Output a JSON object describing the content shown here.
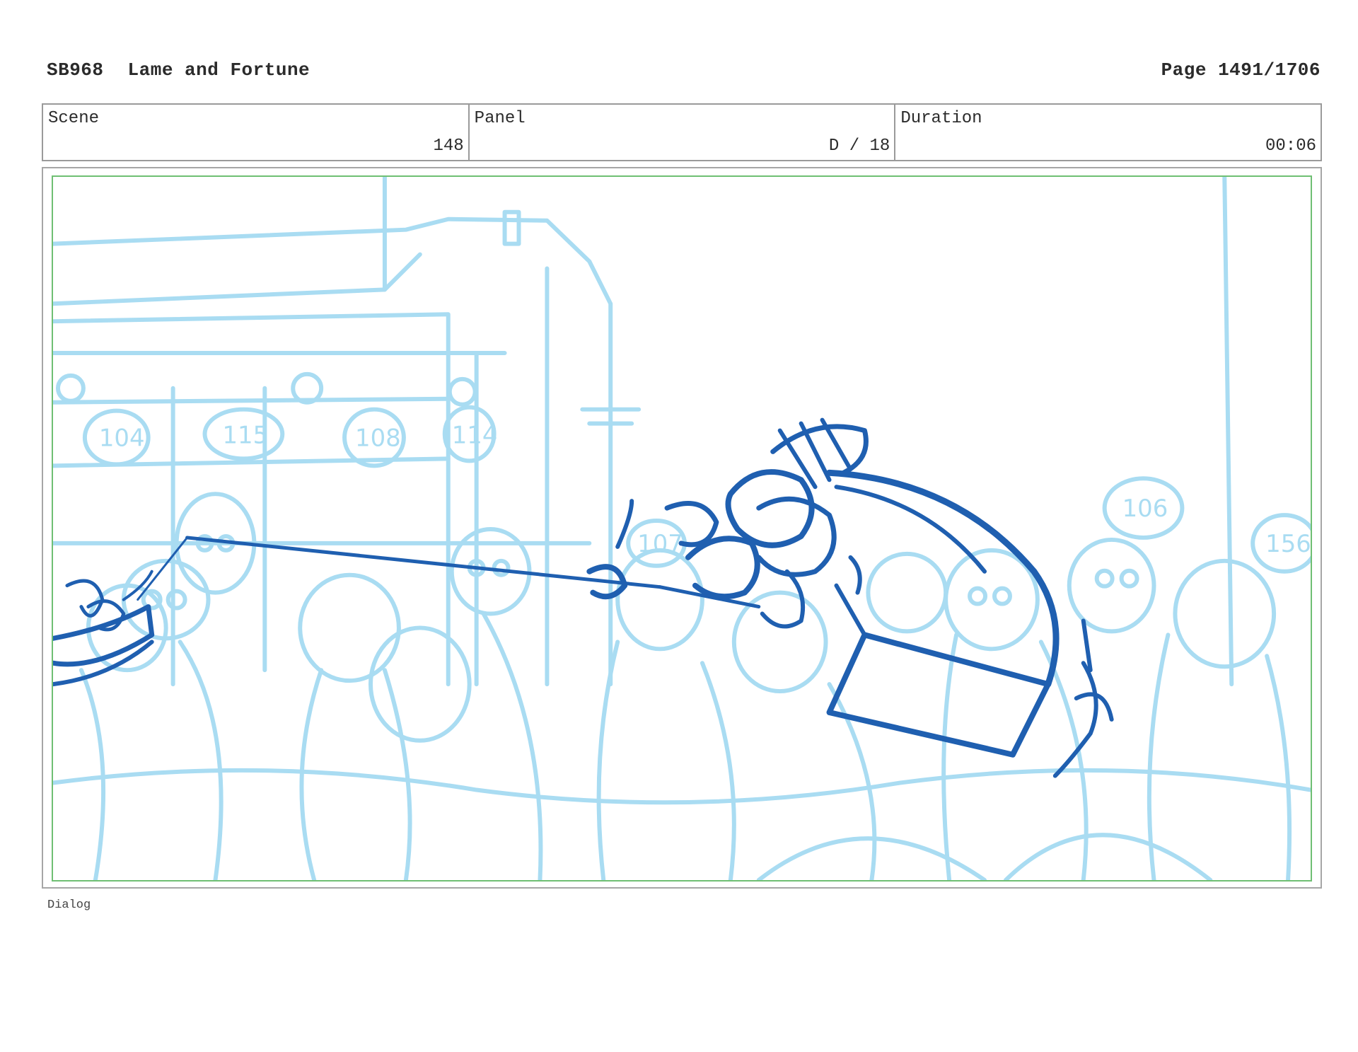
{
  "header": {
    "code": "SB968",
    "title": "Lame and Fortune",
    "page": "Page 1491/1706"
  },
  "info": {
    "scene_label": "Scene",
    "scene_value": "148",
    "panel_label": "Panel",
    "panel_value": "D / 18",
    "duration_label": "Duration",
    "duration_value": "00:06"
  },
  "sketch": {
    "crowd_numbers": [
      "104",
      "115",
      "108",
      "114",
      "107",
      "106",
      "156"
    ],
    "background_color": "#a9dcf2",
    "foreground_color": "#1f5fb0"
  },
  "footer": {
    "dialog_label": "Dialog"
  }
}
